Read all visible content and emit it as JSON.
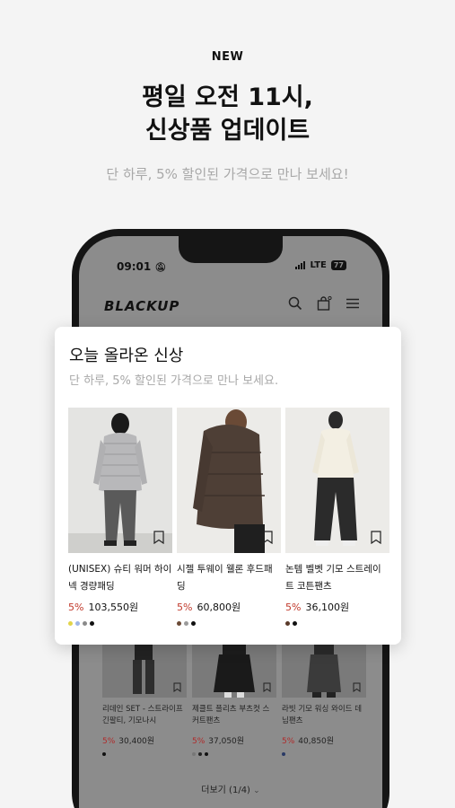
{
  "promo": {
    "badge": "NEW",
    "title_line1": "평일 오전 11시,",
    "title_line2": "신상품 업데이트",
    "subtitle": "단 하루, 5% 할인된 가격으로 만나 보세요!"
  },
  "phone": {
    "status_time": "09:01",
    "network": "LTE",
    "battery": "77",
    "brand": "BLACKUP"
  },
  "feature_card": {
    "title": "오늘 올라온 신상",
    "subtitle": "단 하루, 5% 할인된 가격으로 만나 보세요.",
    "products": [
      {
        "name": "(UNISEX) 슈티 워머 하이넥 경량패딩",
        "discount": "5%",
        "price": "103,550원",
        "swatches": [
          "#e2d44a",
          "#9fb6e6",
          "#8a8a8a",
          "#111111"
        ]
      },
      {
        "name": "시젤 투웨이 웰론 후드패딩",
        "discount": "5%",
        "price": "60,800원",
        "swatches": [
          "#6b4a36",
          "#9b9b9b",
          "#111111"
        ]
      },
      {
        "name": "논템 벨벳 기모 스트레이트 코튼팬츠",
        "discount": "5%",
        "price": "36,100원",
        "swatches": [
          "#5a3a2a",
          "#111111"
        ]
      }
    ]
  },
  "grid": {
    "items": [
      {
        "name": "리데인 SET - 스트라이프 긴팔티, 기모나시",
        "discount": "5%",
        "price": "30,400원",
        "swatches": [
          "#111111"
        ]
      },
      {
        "name": "제클트 플리츠 부츠컷 스커트팬츠",
        "discount": "5%",
        "price": "37,050원",
        "swatches": [
          "#777777",
          "#222222",
          "#111111"
        ]
      },
      {
        "name": "라빗 기모 워싱 와이드 데님팬츠",
        "discount": "5%",
        "price": "40,850원",
        "swatches": [
          "#2a3a66"
        ]
      }
    ],
    "more_label": "더보기 (1/4)"
  }
}
